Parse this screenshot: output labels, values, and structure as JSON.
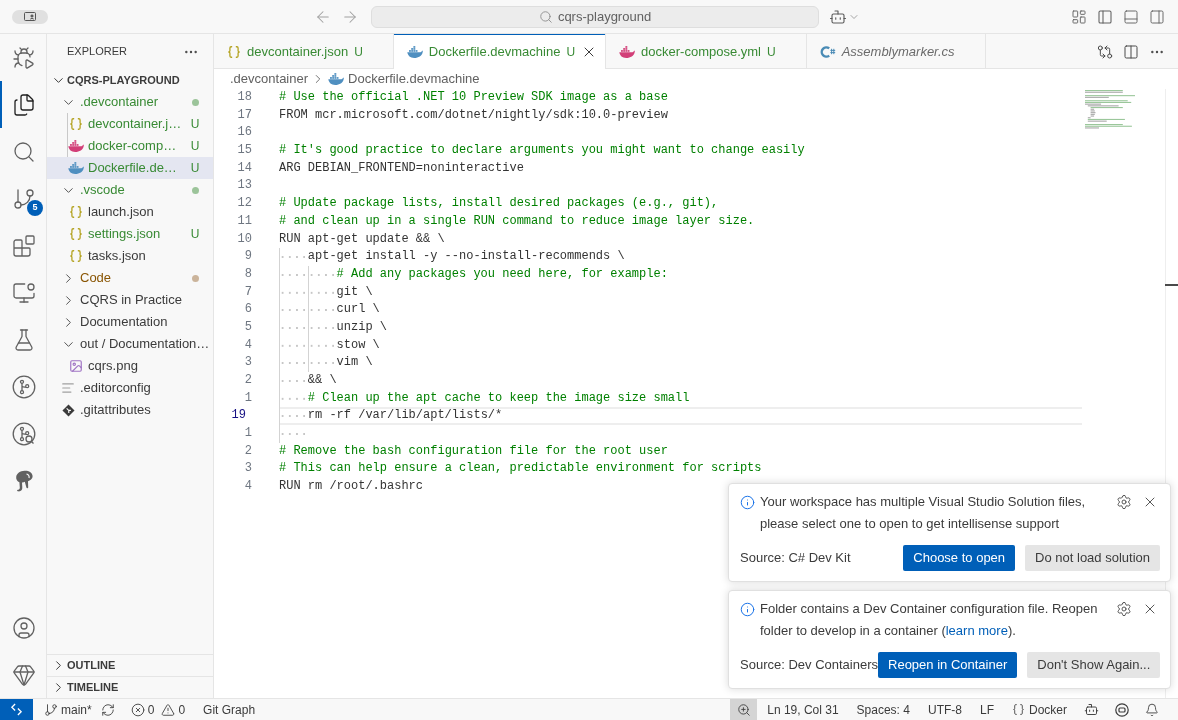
{
  "title_bar": {
    "search": "cqrs-playground"
  },
  "activity_bar": {
    "top": [
      {
        "kind": "run-debug",
        "selected": false
      },
      {
        "kind": "explorer",
        "selected": true
      },
      {
        "kind": "search",
        "selected": false
      },
      {
        "kind": "source-control",
        "selected": false,
        "badge": "5"
      },
      {
        "kind": "extensions",
        "selected": false
      },
      {
        "kind": "remote-explorer",
        "selected": false
      },
      {
        "kind": "testing",
        "selected": false
      },
      {
        "kind": "git-graph",
        "selected": false
      },
      {
        "kind": "git-search",
        "selected": false
      },
      {
        "kind": "elephant",
        "selected": false
      }
    ],
    "bottom": [
      {
        "kind": "accounts",
        "selected": false
      },
      {
        "kind": "manage",
        "selected": false
      }
    ]
  },
  "explorer": {
    "title": "EXPLORER",
    "root": {
      "label": "CQRS-PLAYGROUND",
      "expanded": true,
      "children": [
        {
          "kind": "folder",
          "label": ".devcontainer",
          "expanded": true,
          "untracked": true,
          "modified": false,
          "selected": false,
          "children": [
            {
              "kind": "json",
              "label": "devcontainer.j…",
              "untracked": true,
              "modified": false,
              "badge": "U",
              "selected": false
            },
            {
              "kind": "compose",
              "label": "docker-comp…",
              "untracked": true,
              "modified": false,
              "badge": "U",
              "selected": false
            },
            {
              "kind": "dockerfile",
              "label": "Dockerfile.de…",
              "untracked": true,
              "modified": false,
              "badge": "U",
              "selected": true
            }
          ]
        },
        {
          "kind": "folder",
          "label": ".vscode",
          "expanded": true,
          "untracked": true,
          "modified": false,
          "selected": false,
          "children": [
            {
              "kind": "json",
              "label": "launch.json",
              "untracked": false,
              "modified": false,
              "selected": false
            },
            {
              "kind": "json",
              "label": "settings.json",
              "untracked": true,
              "modified": false,
              "badge": "U",
              "selected": false
            },
            {
              "kind": "json",
              "label": "tasks.json",
              "untracked": false,
              "modified": false,
              "selected": false
            }
          ]
        },
        {
          "kind": "folder",
          "label": "Code",
          "expanded": false,
          "untracked": false,
          "modified": true,
          "selected": false
        },
        {
          "kind": "folder",
          "label": "CQRS in Practice",
          "expanded": false,
          "untracked": false,
          "modified": false,
          "selected": false
        },
        {
          "kind": "folder",
          "label": "Documentation",
          "expanded": false,
          "untracked": false,
          "modified": false,
          "selected": false
        },
        {
          "kind": "folder",
          "label": "out / Documentation…",
          "expanded": true,
          "untracked": false,
          "modified": false,
          "selected": false,
          "children": [
            {
              "kind": "image",
              "label": "cqrs.png",
              "untracked": false,
              "modified": false,
              "selected": false
            }
          ]
        },
        {
          "kind": "editorconfig",
          "label": ".editorconfig",
          "untracked": false,
          "modified": false,
          "selected": false
        },
        {
          "kind": "gitattributes",
          "label": ".gitattributes",
          "untracked": false,
          "modified": false,
          "selected": false
        }
      ]
    },
    "sections": [
      {
        "label": "OUTLINE",
        "expanded": false
      },
      {
        "label": "TIMELINE",
        "expanded": false
      }
    ]
  },
  "editor": {
    "tabs": [
      {
        "kind": "json",
        "label": "devcontainer.json",
        "untracked": true,
        "badge": "U",
        "selected": false,
        "preview": false
      },
      {
        "kind": "dockerfile",
        "label": "Dockerfile.devmachine",
        "untracked": true,
        "badge": "U",
        "selected": true,
        "preview": false
      },
      {
        "kind": "compose",
        "label": "docker-compose.yml",
        "untracked": true,
        "badge": "U",
        "selected": false,
        "preview": false
      },
      {
        "kind": "csharp",
        "label": "Assemblymarker.cs",
        "untracked": false,
        "selected": false,
        "preview": true
      }
    ],
    "breadcrumbs": [
      {
        "kind": "folder",
        "label": ".devcontainer"
      },
      {
        "kind": "dockerfile",
        "label": "Dockerfile.devmachine"
      }
    ],
    "lines": [
      {
        "number": "18",
        "kind": "comment",
        "text": "# Use the official .NET 10 Preview SDK image as a base",
        "current": false
      },
      {
        "number": "17",
        "kind": "code",
        "text": "FROM mcr.microsoft.com/dotnet/nightly/sdk:10.0-preview",
        "current": false
      },
      {
        "number": "16",
        "kind": "blank",
        "current": false
      },
      {
        "number": "15",
        "kind": "comment",
        "text": "# It's good practice to declare arguments you might want to change easily",
        "current": false
      },
      {
        "number": "14",
        "kind": "code",
        "text": "ARG DEBIAN_FRONTEND=noninteractive",
        "current": false
      },
      {
        "number": "13",
        "kind": "blank",
        "current": false
      },
      {
        "number": "12",
        "kind": "comment",
        "text": "# Update package lists, install desired packages (e.g., git),",
        "current": false
      },
      {
        "number": "11",
        "kind": "comment",
        "text": "# and clean up in a single RUN command to reduce image layer size.",
        "current": false
      },
      {
        "number": "10",
        "kind": "code",
        "text": "RUN apt-get update && \\",
        "current": false
      },
      {
        "number": "9",
        "kind": "code",
        "text": "    apt-get install -y --no-install-recommends \\",
        "current": false
      },
      {
        "number": "8",
        "kind": "comment",
        "text": "        # Add any packages you need here, for example:",
        "current": false
      },
      {
        "number": "7",
        "kind": "code",
        "text": "        git \\",
        "current": false
      },
      {
        "number": "6",
        "kind": "code",
        "text": "        curl \\",
        "current": false
      },
      {
        "number": "5",
        "kind": "code",
        "text": "        unzip \\",
        "current": false
      },
      {
        "number": "4",
        "kind": "code",
        "text": "        stow \\",
        "current": false
      },
      {
        "number": "3",
        "kind": "code",
        "text": "        vim \\",
        "current": false
      },
      {
        "number": "2",
        "kind": "code",
        "text": "    && \\",
        "current": false
      },
      {
        "number": "1",
        "kind": "comment",
        "text": "    # Clean up the apt cache to keep the image size small",
        "current": false
      },
      {
        "number": "19",
        "kind": "code",
        "text": "    rm -rf /var/lib/apt/lists/*",
        "current": true
      },
      {
        "number": "1",
        "kind": "blank",
        "current": false
      },
      {
        "number": "2",
        "kind": "comment",
        "text": "# Remove the bash configuration file for the root user",
        "current": false
      },
      {
        "number": "3",
        "kind": "comment",
        "text": "# This can help ensure a clean, predictable environment for scripts",
        "current": false
      },
      {
        "number": "4",
        "kind": "code",
        "text": "RUN rm /root/.bashrc",
        "current": false
      }
    ]
  },
  "notifications": [
    {
      "message": [
        {
          "kind": "text",
          "text": "Your workspace has multiple Visual Studio Solution files, please select one to open to get intellisense support"
        }
      ],
      "source": "Source: C# Dev Kit",
      "actions": [
        {
          "label": "Choose to open",
          "primary": true
        },
        {
          "label": "Do not load solution",
          "primary": false
        }
      ]
    },
    {
      "message": [
        {
          "kind": "text",
          "text": "Folder contains a Dev Container configuration file. Reopen folder to develop in a container ("
        },
        {
          "kind": "link",
          "text": "learn more"
        },
        {
          "kind": "text",
          "text": ")."
        }
      ],
      "source": "Source: Dev Containers",
      "actions": [
        {
          "label": "Reopen in Container",
          "primary": true
        },
        {
          "label": "Don't Show Again...",
          "primary": false
        }
      ]
    }
  ],
  "status_bar": {
    "left": [
      {
        "kind": "remote"
      },
      {
        "kind": "branch",
        "label": "main*"
      },
      {
        "kind": "sync"
      },
      {
        "kind": "problems",
        "errors": "0",
        "warnings": "0"
      },
      {
        "kind": "text",
        "label": "Git Graph"
      }
    ],
    "right": [
      {
        "kind": "zoom",
        "highlighted": true
      },
      {
        "kind": "text",
        "label": "Ln 19, Col 31",
        "highlighted": false
      },
      {
        "kind": "text",
        "label": "Spaces: 4",
        "highlighted": false
      },
      {
        "kind": "text",
        "label": "UTF-8",
        "highlighted": false
      },
      {
        "kind": "text",
        "label": "LF",
        "highlighted": false
      },
      {
        "kind": "language",
        "label": "Docker",
        "highlighted": false
      },
      {
        "kind": "copilot",
        "highlighted": false
      },
      {
        "kind": "extension",
        "highlighted": false
      },
      {
        "kind": "bell",
        "highlighted": false
      }
    ]
  }
}
